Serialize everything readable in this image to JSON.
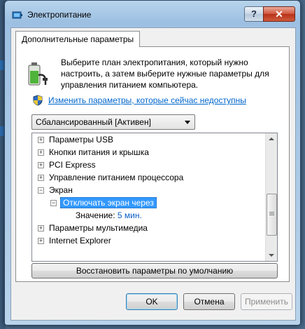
{
  "window": {
    "title": "Электропитание",
    "help_label": "?",
    "close_label": "✕"
  },
  "tab": {
    "label": "Дополнительные параметры"
  },
  "intro": {
    "description": "Выберите план электропитания, который нужно настроить, а затем выберите нужные параметры для управления питанием компьютера.",
    "change_link": "Изменить параметры, которые сейчас недоступны"
  },
  "plan_select": {
    "value": "Сбалансированный [Активен]"
  },
  "tree": {
    "items": [
      {
        "label": "Параметры USB",
        "state": "collapsed"
      },
      {
        "label": "Кнопки питания и крышка",
        "state": "collapsed"
      },
      {
        "label": "PCI Express",
        "state": "collapsed"
      },
      {
        "label": "Управление питанием процессора",
        "state": "collapsed"
      },
      {
        "label": "Экран",
        "state": "expanded"
      },
      {
        "label": "Отключать экран через",
        "state": "expanded",
        "selected": true
      },
      {
        "label": "Значение:",
        "value": "5 мин."
      },
      {
        "label": "Параметры мультимедиа",
        "state": "collapsed"
      },
      {
        "label": "Internet Explorer",
        "state": "collapsed"
      }
    ]
  },
  "restore_button": "Восстановить параметры по умолчанию",
  "buttons": {
    "ok": "OK",
    "cancel": "Отмена",
    "apply": "Применить"
  },
  "colors": {
    "selection": "#3399ff",
    "link": "#0066cc",
    "value": "#0b5ec6"
  },
  "icons": [
    "power-options-icon",
    "battery-plug-icon",
    "uac-shield-icon",
    "expand-plus-icon",
    "collapse-minus-icon"
  ]
}
